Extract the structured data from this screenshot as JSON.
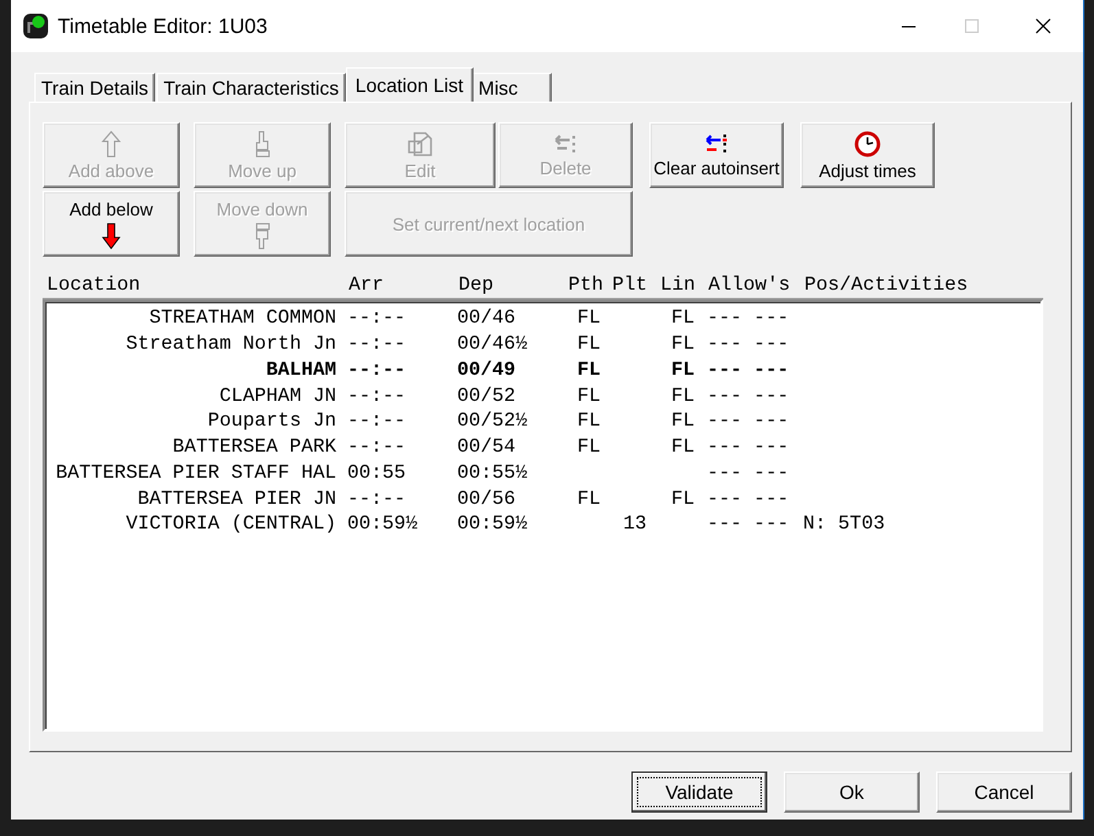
{
  "window": {
    "title": "Timetable Editor: 1U03"
  },
  "tabs": [
    {
      "label": "Train Details",
      "selected": false
    },
    {
      "label": "Train Characteristics",
      "selected": false
    },
    {
      "label": "Location List",
      "selected": true
    },
    {
      "label": "Misc",
      "selected": false
    }
  ],
  "toolbar": [
    {
      "label": "Add above",
      "kind": "icon-above",
      "disabled": true
    },
    {
      "label": "Move up",
      "kind": "icon-above",
      "disabled": true
    },
    {
      "label": "Edit",
      "kind": "icon-above",
      "disabled": true
    },
    {
      "label": "Delete",
      "kind": "icon-above",
      "disabled": true
    },
    {
      "label": "Clear autoinsert",
      "kind": "icon-above",
      "disabled": false
    },
    {
      "label": "Adjust times",
      "kind": "icon-above",
      "disabled": false
    },
    {
      "label": "Add below",
      "kind": "icon-below",
      "disabled": false
    },
    {
      "label": "Move down",
      "kind": "icon-below",
      "disabled": true
    },
    {
      "label": "Set current/next location",
      "kind": "text",
      "disabled": true
    }
  ],
  "table": {
    "columns": [
      "Location",
      "Arr",
      "Dep",
      "Pth",
      "Plt",
      "Lin",
      "Allow's",
      "Pos/Activities"
    ],
    "rows": [
      {
        "location": "STREATHAM COMMON",
        "arr": "--:--",
        "dep": "00/46",
        "pth": "FL",
        "plt": "",
        "lin": "FL",
        "allow": "--- ---",
        "pos": "",
        "bold": false
      },
      {
        "location": "Streatham North Jn",
        "arr": "--:--",
        "dep": "00/46½",
        "pth": "FL",
        "plt": "",
        "lin": "FL",
        "allow": "--- ---",
        "pos": "",
        "bold": false
      },
      {
        "location": "BALHAM",
        "arr": "--:--",
        "dep": "00/49",
        "pth": "FL",
        "plt": "",
        "lin": "FL",
        "allow": "--- ---",
        "pos": "",
        "bold": true
      },
      {
        "location": "CLAPHAM JN",
        "arr": "--:--",
        "dep": "00/52",
        "pth": "FL",
        "plt": "",
        "lin": "FL",
        "allow": "--- ---",
        "pos": "",
        "bold": false
      },
      {
        "location": "Pouparts Jn",
        "arr": "--:--",
        "dep": "00/52½",
        "pth": "FL",
        "plt": "",
        "lin": "FL",
        "allow": "--- ---",
        "pos": "",
        "bold": false
      },
      {
        "location": "BATTERSEA PARK",
        "arr": "--:--",
        "dep": "00/54",
        "pth": "FL",
        "plt": "",
        "lin": "FL",
        "allow": "--- ---",
        "pos": "",
        "bold": false
      },
      {
        "location": "BATTERSEA PIER STAFF HAL",
        "arr": "00:55",
        "dep": "00:55½",
        "pth": "",
        "plt": "",
        "lin": "",
        "allow": "--- ---",
        "pos": "",
        "bold": false
      },
      {
        "location": "BATTERSEA PIER JN",
        "arr": "--:--",
        "dep": "00/56",
        "pth": "FL",
        "plt": "",
        "lin": "FL",
        "allow": "--- ---",
        "pos": "",
        "bold": false
      },
      {
        "location": "VICTORIA (CENTRAL)",
        "arr": "00:59½",
        "dep": "00:59½",
        "pth": "",
        "plt": "13",
        "lin": "",
        "allow": "--- ---",
        "pos": "N: 5T03",
        "bold": false
      }
    ]
  },
  "buttons": [
    {
      "label": "Validate",
      "default": true
    },
    {
      "label": "Ok",
      "default": false
    },
    {
      "label": "Cancel",
      "default": false
    }
  ]
}
